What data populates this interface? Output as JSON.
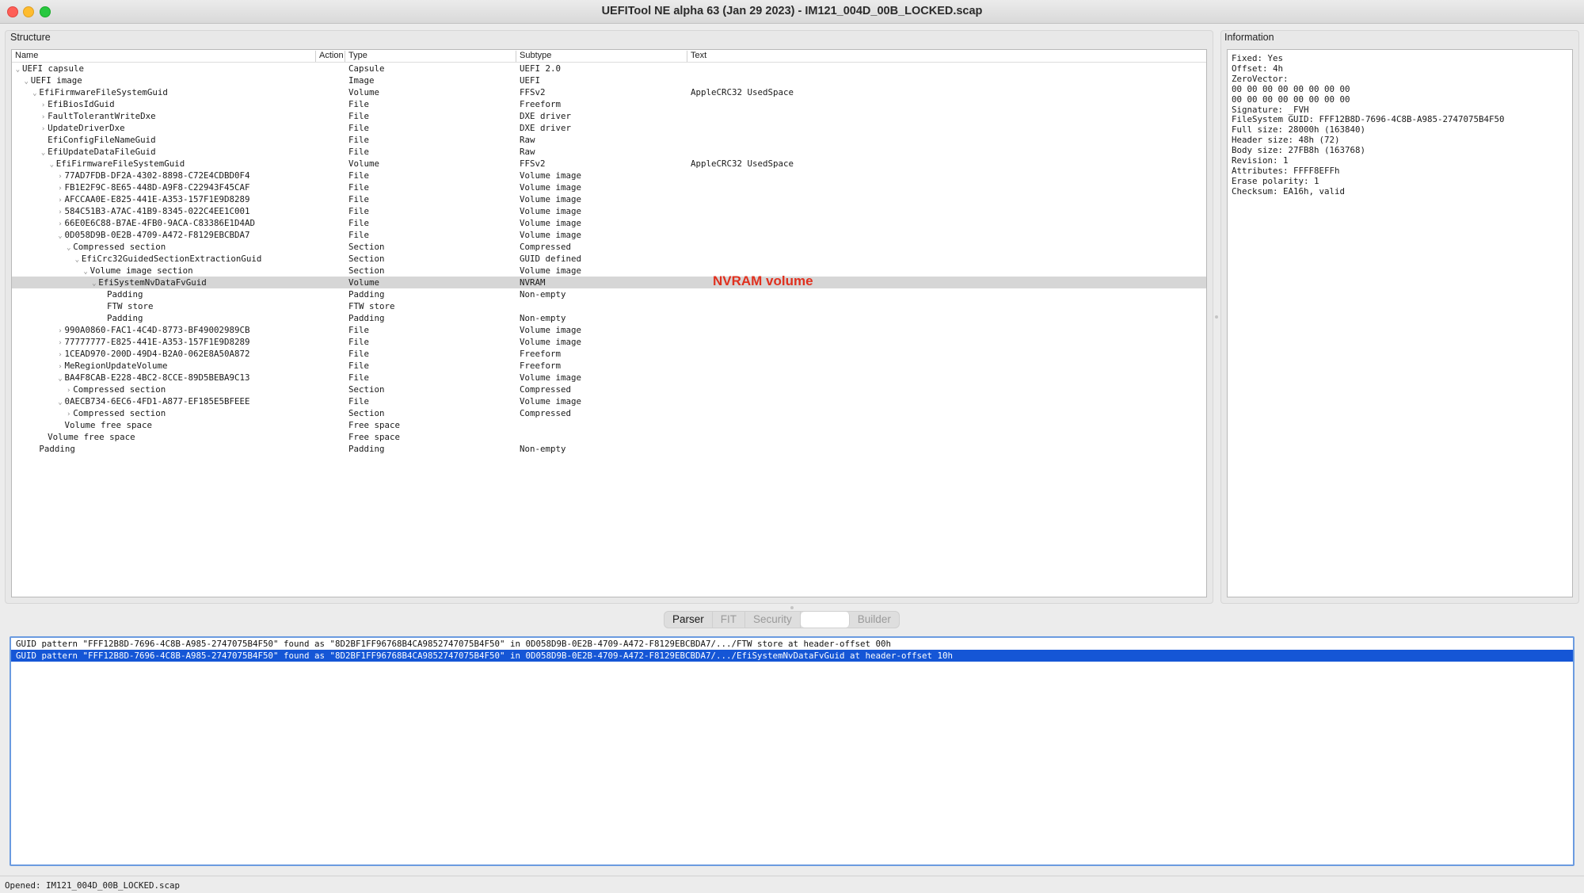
{
  "window": {
    "title": "UEFITool NE alpha 63 (Jan 29 2023) - IM121_004D_00B_LOCKED.scap"
  },
  "structure": {
    "label": "Structure",
    "columns": [
      "Name",
      "Action",
      "Type",
      "Subtype",
      "Text"
    ],
    "rows": [
      {
        "name": "UEFI capsule",
        "depth": 0,
        "expander": "open",
        "action": "",
        "type": "Capsule",
        "subtype": "UEFI 2.0",
        "text": ""
      },
      {
        "name": "UEFI image",
        "depth": 1,
        "expander": "open",
        "action": "",
        "type": "Image",
        "subtype": "UEFI",
        "text": ""
      },
      {
        "name": "EfiFirmwareFileSystemGuid",
        "depth": 2,
        "expander": "open",
        "action": "",
        "type": "Volume",
        "subtype": "FFSv2",
        "text": "AppleCRC32 UsedSpace"
      },
      {
        "name": "EfiBiosIdGuid",
        "depth": 3,
        "expander": "closed",
        "action": "",
        "type": "File",
        "subtype": "Freeform",
        "text": ""
      },
      {
        "name": "FaultTolerantWriteDxe",
        "depth": 3,
        "expander": "closed",
        "action": "",
        "type": "File",
        "subtype": "DXE driver",
        "text": ""
      },
      {
        "name": "UpdateDriverDxe",
        "depth": 3,
        "expander": "closed",
        "action": "",
        "type": "File",
        "subtype": "DXE driver",
        "text": ""
      },
      {
        "name": "EfiConfigFileNameGuid",
        "depth": 3,
        "expander": "none",
        "action": "",
        "type": "File",
        "subtype": "Raw",
        "text": ""
      },
      {
        "name": "EfiUpdateDataFileGuid",
        "depth": 3,
        "expander": "open",
        "action": "",
        "type": "File",
        "subtype": "Raw",
        "text": ""
      },
      {
        "name": "EfiFirmwareFileSystemGuid",
        "depth": 4,
        "expander": "open",
        "action": "",
        "type": "Volume",
        "subtype": "FFSv2",
        "text": "AppleCRC32 UsedSpace"
      },
      {
        "name": "77AD7FDB-DF2A-4302-8898-C72E4CDBD0F4",
        "depth": 5,
        "expander": "closed",
        "action": "",
        "type": "File",
        "subtype": "Volume image",
        "text": ""
      },
      {
        "name": "FB1E2F9C-8E65-448D-A9F8-C22943F45CAF",
        "depth": 5,
        "expander": "closed",
        "action": "",
        "type": "File",
        "subtype": "Volume image",
        "text": ""
      },
      {
        "name": "AFCCAA0E-E825-441E-A353-157F1E9D8289",
        "depth": 5,
        "expander": "closed",
        "action": "",
        "type": "File",
        "subtype": "Volume image",
        "text": ""
      },
      {
        "name": "584C51B3-A7AC-41B9-8345-022C4EE1C001",
        "depth": 5,
        "expander": "closed",
        "action": "",
        "type": "File",
        "subtype": "Volume image",
        "text": ""
      },
      {
        "name": "66E0E6C88-B7AE-4FB0-9ACA-C83386E1D4AD",
        "depth": 5,
        "expander": "closed",
        "action": "",
        "type": "File",
        "subtype": "Volume image",
        "text": ""
      },
      {
        "name": "0D058D9B-0E2B-4709-A472-F8129EBCBDA7",
        "depth": 5,
        "expander": "open",
        "action": "",
        "type": "File",
        "subtype": "Volume image",
        "text": ""
      },
      {
        "name": "Compressed section",
        "depth": 6,
        "expander": "open",
        "action": "",
        "type": "Section",
        "subtype": "Compressed",
        "text": ""
      },
      {
        "name": "EfiCrc32GuidedSectionExtractionGuid",
        "depth": 7,
        "expander": "open",
        "action": "",
        "type": "Section",
        "subtype": "GUID defined",
        "text": ""
      },
      {
        "name": "Volume image section",
        "depth": 8,
        "expander": "open",
        "action": "",
        "type": "Section",
        "subtype": "Volume image",
        "text": ""
      },
      {
        "name": "EfiSystemNvDataFvGuid",
        "depth": 9,
        "expander": "open",
        "action": "",
        "type": "Volume",
        "subtype": "NVRAM",
        "text": "",
        "selected": true
      },
      {
        "name": "Padding",
        "depth": 10,
        "expander": "none",
        "action": "",
        "type": "Padding",
        "subtype": "Non-empty",
        "text": ""
      },
      {
        "name": "FTW store",
        "depth": 10,
        "expander": "none",
        "action": "",
        "type": "FTW store",
        "subtype": "",
        "text": ""
      },
      {
        "name": "Padding",
        "depth": 10,
        "expander": "none",
        "action": "",
        "type": "Padding",
        "subtype": "Non-empty",
        "text": ""
      },
      {
        "name": "990A0860-FAC1-4C4D-8773-BF49002989CB",
        "depth": 5,
        "expander": "closed",
        "action": "",
        "type": "File",
        "subtype": "Volume image",
        "text": ""
      },
      {
        "name": "77777777-E825-441E-A353-157F1E9D8289",
        "depth": 5,
        "expander": "closed",
        "action": "",
        "type": "File",
        "subtype": "Volume image",
        "text": ""
      },
      {
        "name": "1CEAD970-200D-49D4-B2A0-062E8A50A872",
        "depth": 5,
        "expander": "closed",
        "action": "",
        "type": "File",
        "subtype": "Freeform",
        "text": ""
      },
      {
        "name": "MeRegionUpdateVolume",
        "depth": 5,
        "expander": "closed",
        "action": "",
        "type": "File",
        "subtype": "Freeform",
        "text": ""
      },
      {
        "name": "BA4F8CAB-E228-4BC2-8CCE-89D5BEBA9C13",
        "depth": 5,
        "expander": "open",
        "action": "",
        "type": "File",
        "subtype": "Volume image",
        "text": ""
      },
      {
        "name": "Compressed section",
        "depth": 6,
        "expander": "closed",
        "action": "",
        "type": "Section",
        "subtype": "Compressed",
        "text": ""
      },
      {
        "name": "0AECB734-6EC6-4FD1-A877-EF185E5BFEEE",
        "depth": 5,
        "expander": "open",
        "action": "",
        "type": "File",
        "subtype": "Volume image",
        "text": ""
      },
      {
        "name": "Compressed section",
        "depth": 6,
        "expander": "closed",
        "action": "",
        "type": "Section",
        "subtype": "Compressed",
        "text": ""
      },
      {
        "name": "Volume free space",
        "depth": 5,
        "expander": "none",
        "action": "",
        "type": "Free space",
        "subtype": "",
        "text": ""
      },
      {
        "name": "Volume free space",
        "depth": 3,
        "expander": "none",
        "action": "",
        "type": "Free space",
        "subtype": "",
        "text": ""
      },
      {
        "name": "Padding",
        "depth": 2,
        "expander": "none",
        "action": "",
        "type": "Padding",
        "subtype": "Non-empty",
        "text": ""
      }
    ],
    "annotation": "NVRAM volume"
  },
  "information": {
    "label": "Information",
    "lines": [
      "Fixed: Yes",
      "Offset: 4h",
      "ZeroVector:",
      "00 00 00 00 00 00 00 00",
      "00 00 00 00 00 00 00 00",
      "Signature: _FVH",
      "FileSystem GUID: FFF12B8D-7696-4C8B-A985-2747075B4F50",
      "Full size: 28000h (163840)",
      "Header size: 48h (72)",
      "Body size: 27FB8h (163768)",
      "Revision: 1",
      "Attributes: FFFF8EFFh",
      "Erase polarity: 1",
      "Checksum: EA16h, valid"
    ]
  },
  "tabs": {
    "parser": "Parser",
    "fit": "FIT",
    "security": "Security",
    "search": "",
    "builder": "Builder"
  },
  "messages": [
    {
      "text": "GUID pattern \"FFF12B8D-7696-4C8B-A985-2747075B4F50\" found as \"8D2BF1FF96768B4CA9852747075B4F50\" in 0D058D9B-0E2B-4709-A472-F8129EBCBDA7/.../FTW store at header-offset 00h",
      "selected": false
    },
    {
      "text": "GUID pattern \"FFF12B8D-7696-4C8B-A985-2747075B4F50\" found as \"8D2BF1FF96768B4CA9852747075B4F50\" in 0D058D9B-0E2B-4709-A472-F8129EBCBDA7/.../EfiSystemNvDataFvGuid at header-offset 10h",
      "selected": true
    }
  ],
  "status": {
    "text": "Opened: IM121_004D_00B_LOCKED.scap"
  },
  "colors": {
    "selection_blue": "#1556d6",
    "tree_selection": "#d6d6d6",
    "annotation_red": "#e0301e"
  }
}
